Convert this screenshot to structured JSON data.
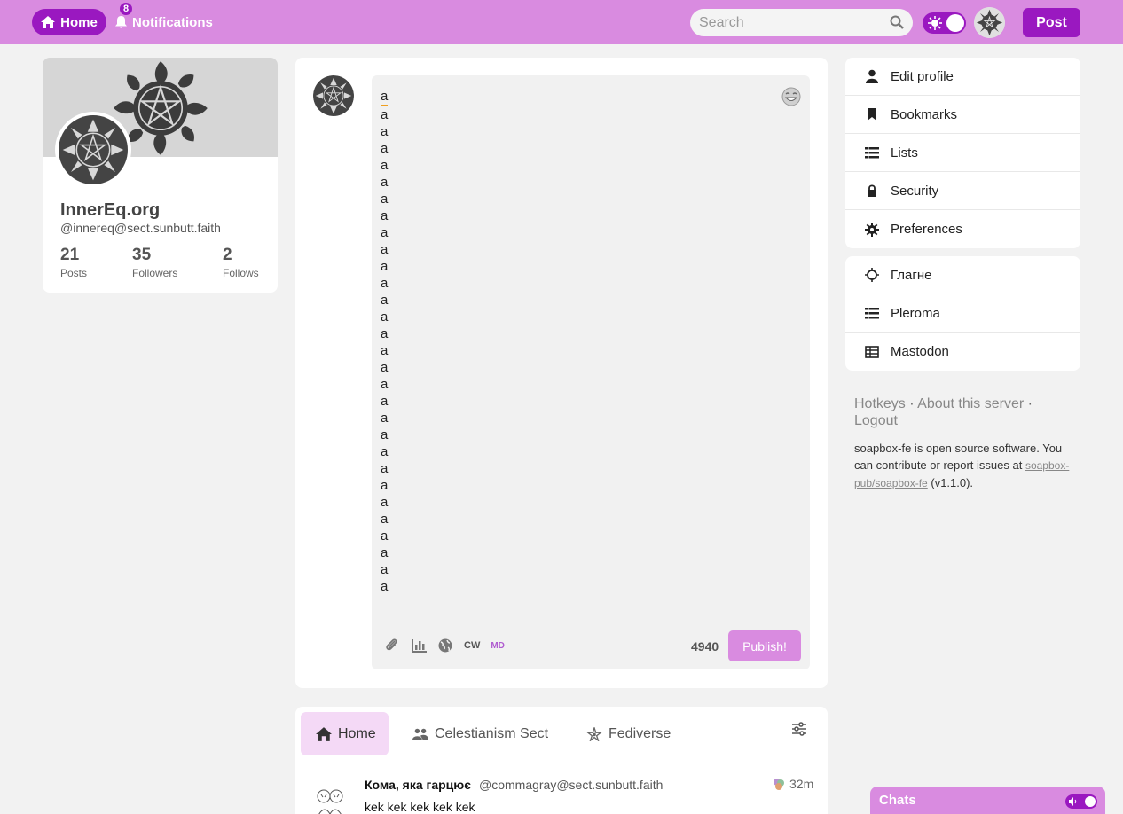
{
  "nav": {
    "home_label": "Home",
    "notifications_label": "Notifications",
    "notifications_count": "8",
    "search_placeholder": "Search",
    "post_label": "Post"
  },
  "profile": {
    "name": "InnerEq.org",
    "handle": "@innereq@sect.sunbutt.faith",
    "stats": [
      {
        "value": "21",
        "label": "Posts"
      },
      {
        "value": "35",
        "label": "Followers"
      },
      {
        "value": "2",
        "label": "Follows"
      }
    ]
  },
  "composer": {
    "lines": [
      "a",
      "a",
      "a",
      "a",
      "a",
      "a",
      "a",
      "a",
      "a",
      "a",
      "a",
      "a",
      "a",
      "a",
      "a",
      "a",
      "a",
      "a",
      "a",
      "a",
      "a",
      "a",
      "a",
      "a",
      "a",
      "a",
      "a",
      "a",
      "a",
      "a"
    ],
    "cw_label": "CW",
    "md_label": "MD",
    "char_count": "4940",
    "publish_label": "Publish!"
  },
  "timeline": {
    "tabs": [
      {
        "label": "Home"
      },
      {
        "label": "Celestianism Sect"
      },
      {
        "label": "Fediverse"
      }
    ],
    "post": {
      "author": "Кома, яка гарцює",
      "handle": "@commagray@sect.sunbutt.faith",
      "time": "32m",
      "text": "kek kek kek kek kek"
    }
  },
  "menu": {
    "primary": [
      {
        "label": "Edit profile",
        "icon": "user-icon"
      },
      {
        "label": "Bookmarks",
        "icon": "bookmark-icon"
      },
      {
        "label": "Lists",
        "icon": "list-icon"
      },
      {
        "label": "Security",
        "icon": "lock-icon"
      },
      {
        "label": "Preferences",
        "icon": "gear-icon"
      }
    ],
    "secondary": [
      {
        "label": "Глагне",
        "icon": "sun-outline-icon"
      },
      {
        "label": "Pleroma",
        "icon": "list-icon"
      },
      {
        "label": "Mastodon",
        "icon": "table-icon"
      }
    ]
  },
  "footer": {
    "hotkeys": "Hotkeys",
    "about": "About this server",
    "logout": "Logout",
    "note": "soapbox-fe is open source software. You can contribute or report issues at",
    "repo": "soapbox-pub/soapbox-fe",
    "version": "(v1.1.0)."
  },
  "chats": {
    "title": "Chats"
  },
  "colors": {
    "accent": "#9a18c0",
    "topbar": "#d98be0",
    "light_accent": "#f4d9f6"
  }
}
